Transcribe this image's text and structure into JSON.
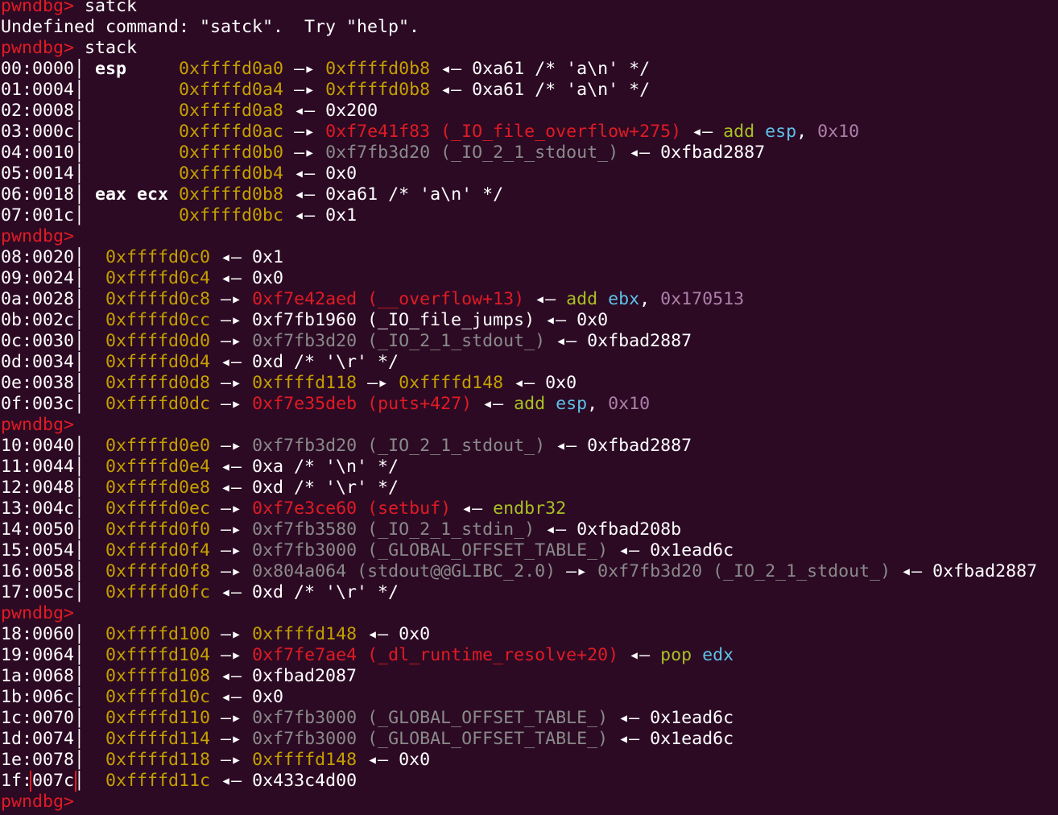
{
  "colors": {
    "background": "#2c0a24",
    "prompt": "#e01b24",
    "address": "#c4a000",
    "code": "#e01b24",
    "data": "#8a8a8a",
    "mnemonic": "#a8c023",
    "register": "#5fc0e8",
    "immediate": "#ad7fa8",
    "text": "#ffffff",
    "highlight_box": "#e01b24"
  },
  "lines": [
    [
      {
        "t": "pwndbg> ",
        "c": "prompt"
      },
      {
        "t": "satck",
        "c": "w"
      }
    ],
    [
      {
        "t": "Undefined command: \"satck\".  Try \"help\".",
        "c": "w"
      }
    ],
    [
      {
        "t": "pwndbg> ",
        "c": "prompt"
      },
      {
        "t": "stack",
        "c": "w"
      }
    ],
    [
      {
        "t": "00:0000",
        "c": "w"
      },
      {
        "t": "│ ",
        "c": "sep"
      },
      {
        "t": "esp     ",
        "c": "bold"
      },
      {
        "t": "0xffffd0a0",
        "c": "y"
      },
      {
        "t": " —▸ ",
        "c": "w"
      },
      {
        "t": "0xffffd0b8",
        "c": "y"
      },
      {
        "t": " ◂— 0xa61 /* 'a\\n' */",
        "c": "w"
      }
    ],
    [
      {
        "t": "01:0004",
        "c": "w"
      },
      {
        "t": "│ ",
        "c": "sep"
      },
      {
        "t": "        ",
        "c": "w"
      },
      {
        "t": "0xffffd0a4",
        "c": "y"
      },
      {
        "t": " —▸ ",
        "c": "w"
      },
      {
        "t": "0xffffd0b8",
        "c": "y"
      },
      {
        "t": " ◂— 0xa61 /* 'a\\n' */",
        "c": "w"
      }
    ],
    [
      {
        "t": "02:0008",
        "c": "w"
      },
      {
        "t": "│ ",
        "c": "sep"
      },
      {
        "t": "        ",
        "c": "w"
      },
      {
        "t": "0xffffd0a8",
        "c": "y"
      },
      {
        "t": " ◂— 0x200",
        "c": "w"
      }
    ],
    [
      {
        "t": "03:000c",
        "c": "w"
      },
      {
        "t": "│ ",
        "c": "sep"
      },
      {
        "t": "        ",
        "c": "w"
      },
      {
        "t": "0xffffd0ac",
        "c": "y"
      },
      {
        "t": " —▸ ",
        "c": "w"
      },
      {
        "t": "0xf7e41f83 (_IO_file_overflow+275)",
        "c": "r"
      },
      {
        "t": " ◂— ",
        "c": "w"
      },
      {
        "t": "add ",
        "c": "gn"
      },
      {
        "t": "esp",
        "c": "b"
      },
      {
        "t": ", ",
        "c": "w"
      },
      {
        "t": "0x10",
        "c": "p"
      }
    ],
    [
      {
        "t": "04:0010",
        "c": "w"
      },
      {
        "t": "│ ",
        "c": "sep"
      },
      {
        "t": "        ",
        "c": "w"
      },
      {
        "t": "0xffffd0b0",
        "c": "y"
      },
      {
        "t": " —▸ ",
        "c": "w"
      },
      {
        "t": "0xf7fb3d20 (_IO_2_1_stdout_)",
        "c": "g"
      },
      {
        "t": " ◂— 0xfbad2887",
        "c": "w"
      }
    ],
    [
      {
        "t": "05:0014",
        "c": "w"
      },
      {
        "t": "│ ",
        "c": "sep"
      },
      {
        "t": "        ",
        "c": "w"
      },
      {
        "t": "0xffffd0b4",
        "c": "y"
      },
      {
        "t": " ◂— 0x0",
        "c": "w"
      }
    ],
    [
      {
        "t": "06:0018",
        "c": "w"
      },
      {
        "t": "│ ",
        "c": "sep"
      },
      {
        "t": "eax ecx ",
        "c": "bold"
      },
      {
        "t": "0xffffd0b8",
        "c": "y"
      },
      {
        "t": " ◂— 0xa61 /* 'a\\n' */",
        "c": "w"
      }
    ],
    [
      {
        "t": "07:001c",
        "c": "w"
      },
      {
        "t": "│ ",
        "c": "sep"
      },
      {
        "t": "        ",
        "c": "w"
      },
      {
        "t": "0xffffd0bc",
        "c": "y"
      },
      {
        "t": " ◂— 0x1",
        "c": "w"
      }
    ],
    [
      {
        "t": "pwndbg> ",
        "c": "prompt"
      }
    ],
    [
      {
        "t": "08:0020",
        "c": "w"
      },
      {
        "t": "│  ",
        "c": "sep"
      },
      {
        "t": "0xffffd0c0",
        "c": "y"
      },
      {
        "t": " ◂— 0x1",
        "c": "w"
      }
    ],
    [
      {
        "t": "09:0024",
        "c": "w"
      },
      {
        "t": "│  ",
        "c": "sep"
      },
      {
        "t": "0xffffd0c4",
        "c": "y"
      },
      {
        "t": " ◂— 0x0",
        "c": "w"
      }
    ],
    [
      {
        "t": "0a:0028",
        "c": "w"
      },
      {
        "t": "│  ",
        "c": "sep"
      },
      {
        "t": "0xffffd0c8",
        "c": "y"
      },
      {
        "t": " —▸ ",
        "c": "w"
      },
      {
        "t": "0xf7e42aed (__overflow+13)",
        "c": "r"
      },
      {
        "t": " ◂— ",
        "c": "w"
      },
      {
        "t": "add ",
        "c": "gn"
      },
      {
        "t": "ebx",
        "c": "b"
      },
      {
        "t": ", ",
        "c": "w"
      },
      {
        "t": "0x170513",
        "c": "p"
      }
    ],
    [
      {
        "t": "0b:002c",
        "c": "w"
      },
      {
        "t": "│  ",
        "c": "sep"
      },
      {
        "t": "0xffffd0cc",
        "c": "y"
      },
      {
        "t": " —▸ 0xf7fb1960 (_IO_file_jumps) ◂— 0x0",
        "c": "w"
      }
    ],
    [
      {
        "t": "0c:0030",
        "c": "w"
      },
      {
        "t": "│  ",
        "c": "sep"
      },
      {
        "t": "0xffffd0d0",
        "c": "y"
      },
      {
        "t": " —▸ ",
        "c": "w"
      },
      {
        "t": "0xf7fb3d20 (_IO_2_1_stdout_)",
        "c": "g"
      },
      {
        "t": " ◂— 0xfbad2887",
        "c": "w"
      }
    ],
    [
      {
        "t": "0d:0034",
        "c": "w"
      },
      {
        "t": "│  ",
        "c": "sep"
      },
      {
        "t": "0xffffd0d4",
        "c": "y"
      },
      {
        "t": " ◂— 0xd /* '\\r' */",
        "c": "w"
      }
    ],
    [
      {
        "t": "0e:0038",
        "c": "w"
      },
      {
        "t": "│  ",
        "c": "sep"
      },
      {
        "t": "0xffffd0d8",
        "c": "y"
      },
      {
        "t": " —▸ ",
        "c": "w"
      },
      {
        "t": "0xffffd118",
        "c": "y"
      },
      {
        "t": " —▸ ",
        "c": "w"
      },
      {
        "t": "0xffffd148",
        "c": "y"
      },
      {
        "t": " ◂— 0x0",
        "c": "w"
      }
    ],
    [
      {
        "t": "0f:003c",
        "c": "w"
      },
      {
        "t": "│  ",
        "c": "sep"
      },
      {
        "t": "0xffffd0dc",
        "c": "y"
      },
      {
        "t": " —▸ ",
        "c": "w"
      },
      {
        "t": "0xf7e35deb (puts+427)",
        "c": "r"
      },
      {
        "t": " ◂— ",
        "c": "w"
      },
      {
        "t": "add ",
        "c": "gn"
      },
      {
        "t": "esp",
        "c": "b"
      },
      {
        "t": ", ",
        "c": "w"
      },
      {
        "t": "0x10",
        "c": "p"
      }
    ],
    [
      {
        "t": "pwndbg> ",
        "c": "prompt"
      }
    ],
    [
      {
        "t": "10:0040",
        "c": "w"
      },
      {
        "t": "│  ",
        "c": "sep"
      },
      {
        "t": "0xffffd0e0",
        "c": "y"
      },
      {
        "t": " —▸ ",
        "c": "w"
      },
      {
        "t": "0xf7fb3d20 (_IO_2_1_stdout_)",
        "c": "g"
      },
      {
        "t": " ◂— 0xfbad2887",
        "c": "w"
      }
    ],
    [
      {
        "t": "11:0044",
        "c": "w"
      },
      {
        "t": "│  ",
        "c": "sep"
      },
      {
        "t": "0xffffd0e4",
        "c": "y"
      },
      {
        "t": " ◂— 0xa /* '\\n' */",
        "c": "w"
      }
    ],
    [
      {
        "t": "12:0048",
        "c": "w"
      },
      {
        "t": "│  ",
        "c": "sep"
      },
      {
        "t": "0xffffd0e8",
        "c": "y"
      },
      {
        "t": " ◂— 0xd /* '\\r' */",
        "c": "w"
      }
    ],
    [
      {
        "t": "13:004c",
        "c": "w"
      },
      {
        "t": "│  ",
        "c": "sep"
      },
      {
        "t": "0xffffd0ec",
        "c": "y"
      },
      {
        "t": " —▸ ",
        "c": "w"
      },
      {
        "t": "0xf7e3ce60 (setbuf)",
        "c": "r"
      },
      {
        "t": " ◂— ",
        "c": "w"
      },
      {
        "t": "endbr32",
        "c": "gn"
      }
    ],
    [
      {
        "t": "14:0050",
        "c": "w"
      },
      {
        "t": "│  ",
        "c": "sep"
      },
      {
        "t": "0xffffd0f0",
        "c": "y"
      },
      {
        "t": " —▸ ",
        "c": "w"
      },
      {
        "t": "0xf7fb3580 (_IO_2_1_stdin_)",
        "c": "g"
      },
      {
        "t": " ◂— 0xfbad208b",
        "c": "w"
      }
    ],
    [
      {
        "t": "15:0054",
        "c": "w"
      },
      {
        "t": "│  ",
        "c": "sep"
      },
      {
        "t": "0xffffd0f4",
        "c": "y"
      },
      {
        "t": " —▸ ",
        "c": "w"
      },
      {
        "t": "0xf7fb3000 (_GLOBAL_OFFSET_TABLE_)",
        "c": "g"
      },
      {
        "t": " ◂— 0x1ead6c",
        "c": "w"
      }
    ],
    [
      {
        "t": "16:0058",
        "c": "w"
      },
      {
        "t": "│  ",
        "c": "sep"
      },
      {
        "t": "0xffffd0f8",
        "c": "y"
      },
      {
        "t": " —▸ ",
        "c": "w"
      },
      {
        "t": "0x804a064 (stdout@@GLIBC_2.0)",
        "c": "g"
      },
      {
        "t": " —▸ ",
        "c": "w"
      },
      {
        "t": "0xf7fb3d20 (_IO_2_1_stdout_)",
        "c": "g"
      },
      {
        "t": " ◂— 0xfbad2887",
        "c": "w"
      }
    ],
    [
      {
        "t": "17:005c",
        "c": "w"
      },
      {
        "t": "│  ",
        "c": "sep"
      },
      {
        "t": "0xffffd0fc",
        "c": "y"
      },
      {
        "t": " ◂— 0xd /* '\\r' */",
        "c": "w"
      }
    ],
    [
      {
        "t": "pwndbg> ",
        "c": "prompt"
      }
    ],
    [
      {
        "t": "18:0060",
        "c": "w"
      },
      {
        "t": "│  ",
        "c": "sep"
      },
      {
        "t": "0xffffd100",
        "c": "y"
      },
      {
        "t": " —▸ ",
        "c": "w"
      },
      {
        "t": "0xffffd148",
        "c": "y"
      },
      {
        "t": " ◂— 0x0",
        "c": "w"
      }
    ],
    [
      {
        "t": "19:0064",
        "c": "w"
      },
      {
        "t": "│  ",
        "c": "sep"
      },
      {
        "t": "0xffffd104",
        "c": "y"
      },
      {
        "t": " —▸ ",
        "c": "w"
      },
      {
        "t": "0xf7fe7ae4 (_dl_runtime_resolve+20)",
        "c": "r"
      },
      {
        "t": " ◂— ",
        "c": "w"
      },
      {
        "t": "pop ",
        "c": "gn"
      },
      {
        "t": "edx",
        "c": "b"
      }
    ],
    [
      {
        "t": "1a:0068",
        "c": "w"
      },
      {
        "t": "│  ",
        "c": "sep"
      },
      {
        "t": "0xffffd108",
        "c": "y"
      },
      {
        "t": " ◂— 0xfbad2087",
        "c": "w"
      }
    ],
    [
      {
        "t": "1b:006c",
        "c": "w"
      },
      {
        "t": "│  ",
        "c": "sep"
      },
      {
        "t": "0xffffd10c",
        "c": "y"
      },
      {
        "t": " ◂— 0x0",
        "c": "w"
      }
    ],
    [
      {
        "t": "1c:0070",
        "c": "w"
      },
      {
        "t": "│  ",
        "c": "sep"
      },
      {
        "t": "0xffffd110",
        "c": "y"
      },
      {
        "t": " —▸ ",
        "c": "w"
      },
      {
        "t": "0xf7fb3000 (_GLOBAL_OFFSET_TABLE_)",
        "c": "g"
      },
      {
        "t": " ◂— 0x1ead6c",
        "c": "w"
      }
    ],
    [
      {
        "t": "1d:0074",
        "c": "w"
      },
      {
        "t": "│  ",
        "c": "sep"
      },
      {
        "t": "0xffffd114",
        "c": "y"
      },
      {
        "t": " —▸ ",
        "c": "w"
      },
      {
        "t": "0xf7fb3000 (_GLOBAL_OFFSET_TABLE_)",
        "c": "g"
      },
      {
        "t": " ◂— 0x1ead6c",
        "c": "w"
      }
    ],
    [
      {
        "t": "1e:0078",
        "c": "w"
      },
      {
        "t": "│  ",
        "c": "sep"
      },
      {
        "t": "0xffffd118",
        "c": "y"
      },
      {
        "t": " —▸ ",
        "c": "w"
      },
      {
        "t": "0xffffd148",
        "c": "y"
      },
      {
        "t": " ◂— 0x0",
        "c": "w"
      }
    ],
    [
      {
        "t": "1f:",
        "c": "w"
      },
      {
        "t": "007c",
        "c": "w",
        "hl": true
      },
      {
        "t": "│  ",
        "c": "sep"
      },
      {
        "t": "0xffffd11c",
        "c": "y"
      },
      {
        "t": " ◂— 0x433c4d00",
        "c": "w"
      }
    ],
    [
      {
        "t": "pwndbg> ",
        "c": "prompt"
      }
    ]
  ]
}
